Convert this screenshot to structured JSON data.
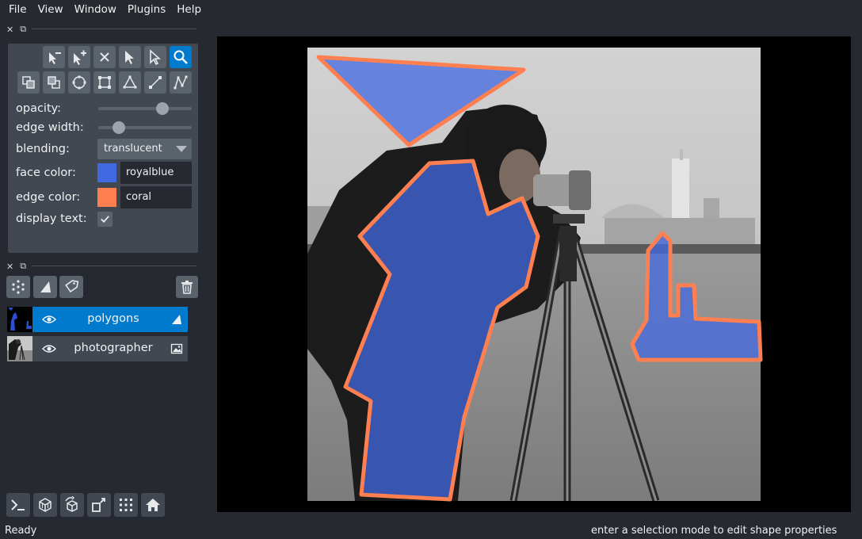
{
  "menu": {
    "items": [
      {
        "label": "File",
        "mnemonic": "F"
      },
      {
        "label": "View",
        "mnemonic": "V"
      },
      {
        "label": "Window",
        "mnemonic": "W"
      },
      {
        "label": "Plugins",
        "mnemonic": "P"
      },
      {
        "label": "Help",
        "mnemonic": "H"
      }
    ]
  },
  "layer_controls": {
    "opacity_label": "opacity:",
    "opacity_value": 0.72,
    "edge_width_label": "edge width:",
    "edge_width_value": 0.18,
    "blending_label": "blending:",
    "blending_value": "translucent",
    "face_color_label": "face color:",
    "face_color_value": "royalblue",
    "face_color_hex": "#4169e1",
    "edge_color_label": "edge color:",
    "edge_color_value": "coral",
    "edge_color_hex": "#ff7f50",
    "display_text_label": "display text:",
    "display_text_checked": true
  },
  "layers": [
    {
      "name": "polygons",
      "selected": true,
      "visible": true,
      "type": "shapes"
    },
    {
      "name": "photographer",
      "selected": false,
      "visible": true,
      "type": "image"
    }
  ],
  "status": {
    "left": "Ready",
    "right": "enter a selection mode to edit shape properties"
  },
  "colors": {
    "accent": "#007acc",
    "background": "#262930",
    "panel": "#414851",
    "button": "#5a626c"
  }
}
